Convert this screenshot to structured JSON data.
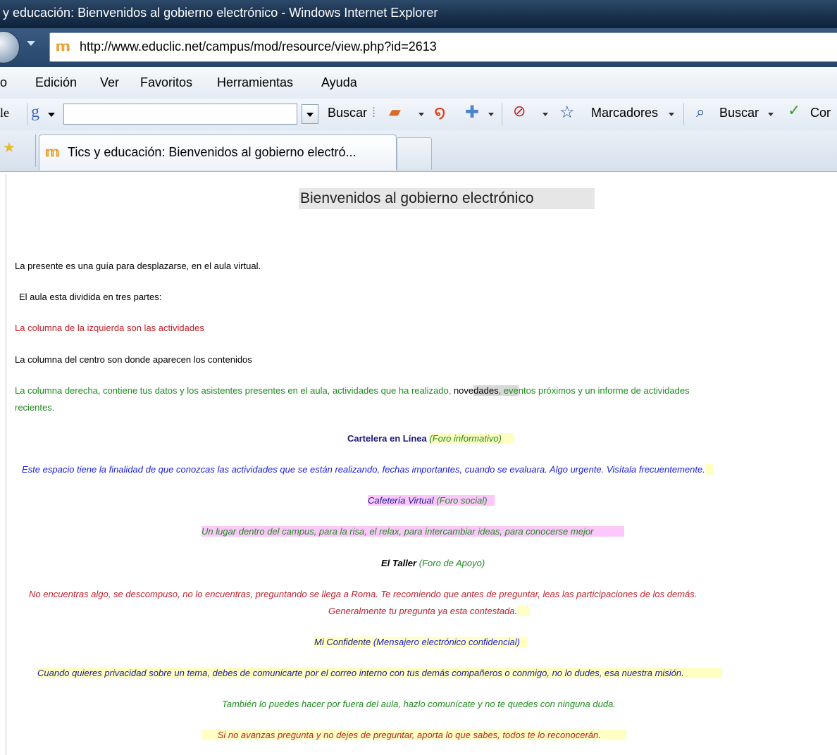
{
  "window": {
    "title": "y educación: Bienvenidos al gobierno electrónico - Windows Internet Explorer"
  },
  "address_bar": {
    "url": "http://www.educlic.net/campus/mod/resource/view.php?id=2613",
    "favicon": "moodle-m-icon"
  },
  "menu": {
    "items": [
      "o",
      "Edición",
      "Ver",
      "Favoritos",
      "Herramientas",
      "Ayuda"
    ]
  },
  "toolbar": {
    "google_fragment": "le",
    "search_label": "Buscar",
    "bookmarks_label": "Marcadores",
    "find_label": "Buscar",
    "spell_label": "Cor"
  },
  "tabs": [
    {
      "label": "Tics y educación: Bienvenidos al gobierno electró..."
    }
  ],
  "page": {
    "title": "Bienvenidos al gobierno electrónico",
    "intro": "La presente es una guía para desplazarse, en el aula virtual.",
    "divided": "El aula esta dividida en tres partes:",
    "left_col": "La columna de la izquierda son las actividades",
    "center_col": "La columna del centro son donde aparecen los contenidos",
    "right_col": {
      "part1": "La columna derecha, contiene tus datos y los asistentes presentes en el aula, actividades que ha realizado, ",
      "part2": "nove",
      "part3": "dades",
      "part4": ", ",
      "part5": "eve",
      "part6": "ntos próximos y un informe de actividades",
      "line2": "recientes."
    },
    "sections": [
      {
        "name": "Cartelera en Línea",
        "type": "(Foro informativo)",
        "desc": "Este espacio tiene la finalidad de que conozcas las actividades que se están realizando, fechas importantes, cuando se evaluara. Algo urgente. Visítala frecuentemente."
      },
      {
        "name": "Cafetería Virtual",
        "type": "(Foro social)",
        "desc": "Un lugar dentro del campus, para la risa, el relax, para intercambiar ideas, para conocerse mejor"
      },
      {
        "name": "El Taller",
        "type": "(Foro de Apoyo)",
        "desc1": "No encuentras algo, se descompuso, no lo encuentras, preguntando se llega a Roma. Te recomiendo que antes de preguntar, leas las participaciones de los demás.",
        "desc2": "Generalmente tu pregunta ya esta contestada."
      },
      {
        "name": "Mi Confidente",
        "type": "(Mensajero electrónico confidencial)",
        "desc": "Cuando  quieres privacidad sobre un tema,  debes de  comunicarte por el correo interno con tus demás compañeros o conmigo, no lo dudes, esa nuestra misión."
      }
    ],
    "outside": "También  lo puedes hacer por fuera del aula, hazlo comunícate y no te quedes con ninguna duda.",
    "closing": "Si no avanzas pregunta y no dejes de preguntar, aporta lo que sabes, todos te lo reconocerán."
  }
}
